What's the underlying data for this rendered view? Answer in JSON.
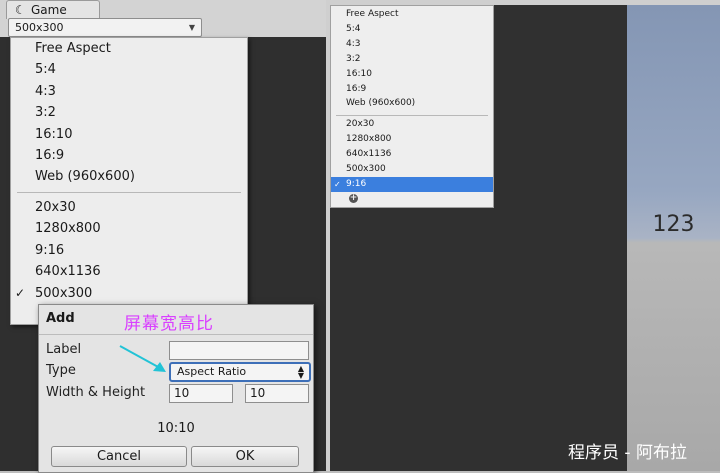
{
  "left_panel": {
    "tab_title": "Game",
    "tab_icon": "unity-game-icon",
    "resolution_dropdown_value": "500x300",
    "menu": {
      "builtin": [
        "Free Aspect",
        "5:4",
        "4:3",
        "3:2",
        "16:10",
        "16:9",
        "Web (960x600)"
      ],
      "custom": [
        "20x30",
        "1280x800",
        "9:16",
        "640x1136",
        "500x300"
      ],
      "selected": "500x300",
      "check_glyph": "✓"
    },
    "add_dialog": {
      "title": "Add",
      "label_label": "Label",
      "label_value": "",
      "type_label": "Type",
      "type_value": "Aspect Ratio",
      "wh_label": "Width & Height",
      "width_value": "10",
      "height_value": "10",
      "preview": "10:10",
      "cancel": "Cancel",
      "ok": "OK"
    },
    "annotation": "屏幕宽高比",
    "annotation_color": "#d940ff",
    "arrow_color": "#22c3d6"
  },
  "right_panel": {
    "menu": {
      "builtin": [
        "Free Aspect",
        "5:4",
        "4:3",
        "3:2",
        "16:10",
        "16:9",
        "Web (960x600)"
      ],
      "custom": [
        "20x30",
        "1280x800",
        "640x1136",
        "500x300",
        "9:16"
      ],
      "selected": "9:16",
      "check_glyph": "✓",
      "add_glyph": "+"
    },
    "scene_text": "123",
    "selection_color": "#3b7fde"
  },
  "watermark": "程序员 - 阿布拉"
}
